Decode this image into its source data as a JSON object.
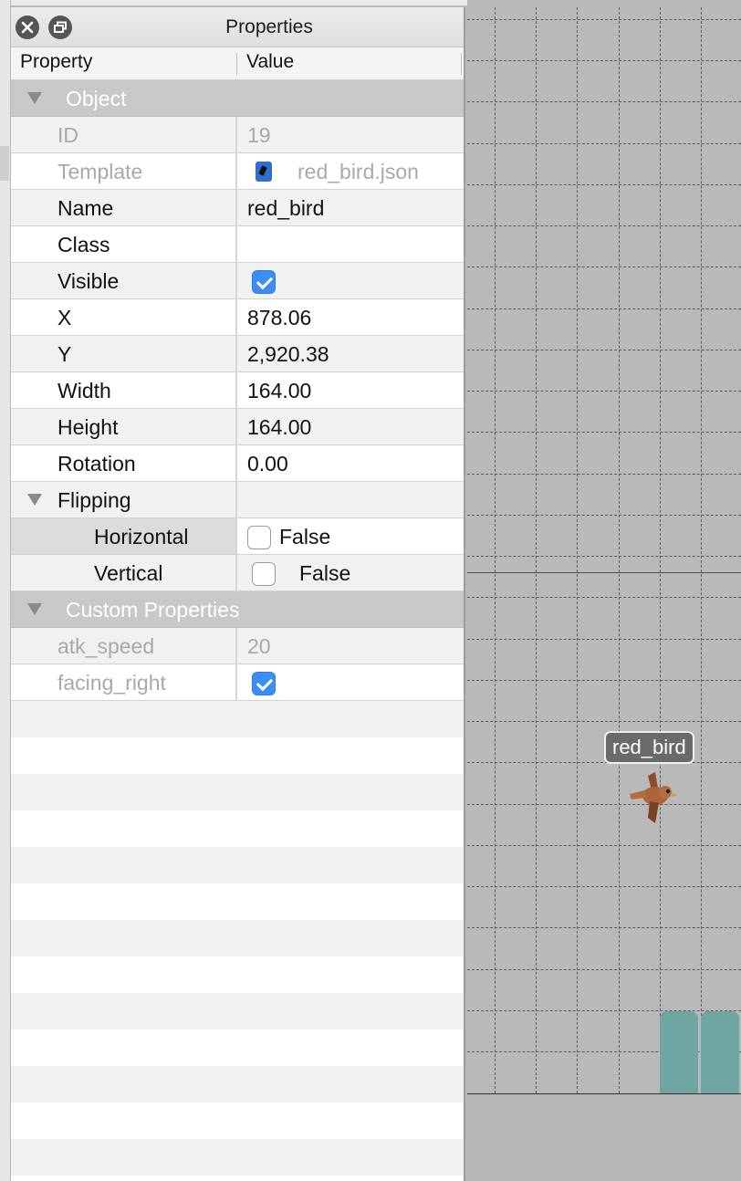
{
  "window": {
    "title": "Properties"
  },
  "columns": {
    "property": "Property",
    "value": "Value"
  },
  "groups": {
    "object": "Object",
    "custom": "Custom Properties"
  },
  "object_rows": {
    "id": {
      "label": "ID",
      "value": "19"
    },
    "template": {
      "label": "Template",
      "value": "red_bird.json"
    },
    "name": {
      "label": "Name",
      "value": "red_bird"
    },
    "class": {
      "label": "Class",
      "value": ""
    },
    "visible": {
      "label": "Visible",
      "checked": true
    },
    "x": {
      "label": "X",
      "value": "878.06"
    },
    "y": {
      "label": "Y",
      "value": "2,920.38"
    },
    "width": {
      "label": "Width",
      "value": "164.00"
    },
    "height": {
      "label": "Height",
      "value": "164.00"
    },
    "rotation": {
      "label": "Rotation",
      "value": "0.00"
    },
    "flipping": {
      "label": "Flipping"
    },
    "horizontal": {
      "label": "Horizontal",
      "value": "False",
      "checked": false
    },
    "vertical": {
      "label": "Vertical",
      "value": "False",
      "checked": false
    }
  },
  "custom_rows": {
    "atk_speed": {
      "label": "atk_speed",
      "value": "20"
    },
    "facing_right": {
      "label": "facing_right",
      "checked": true
    }
  },
  "map": {
    "object_label": "red_bird",
    "tile_color": "#6fa6a1",
    "bird_color": "#a9643a"
  },
  "colors": {
    "accent": "#3d8ef3",
    "group_header": "#c8c8c8",
    "alt_row": "#f0f1f1"
  }
}
